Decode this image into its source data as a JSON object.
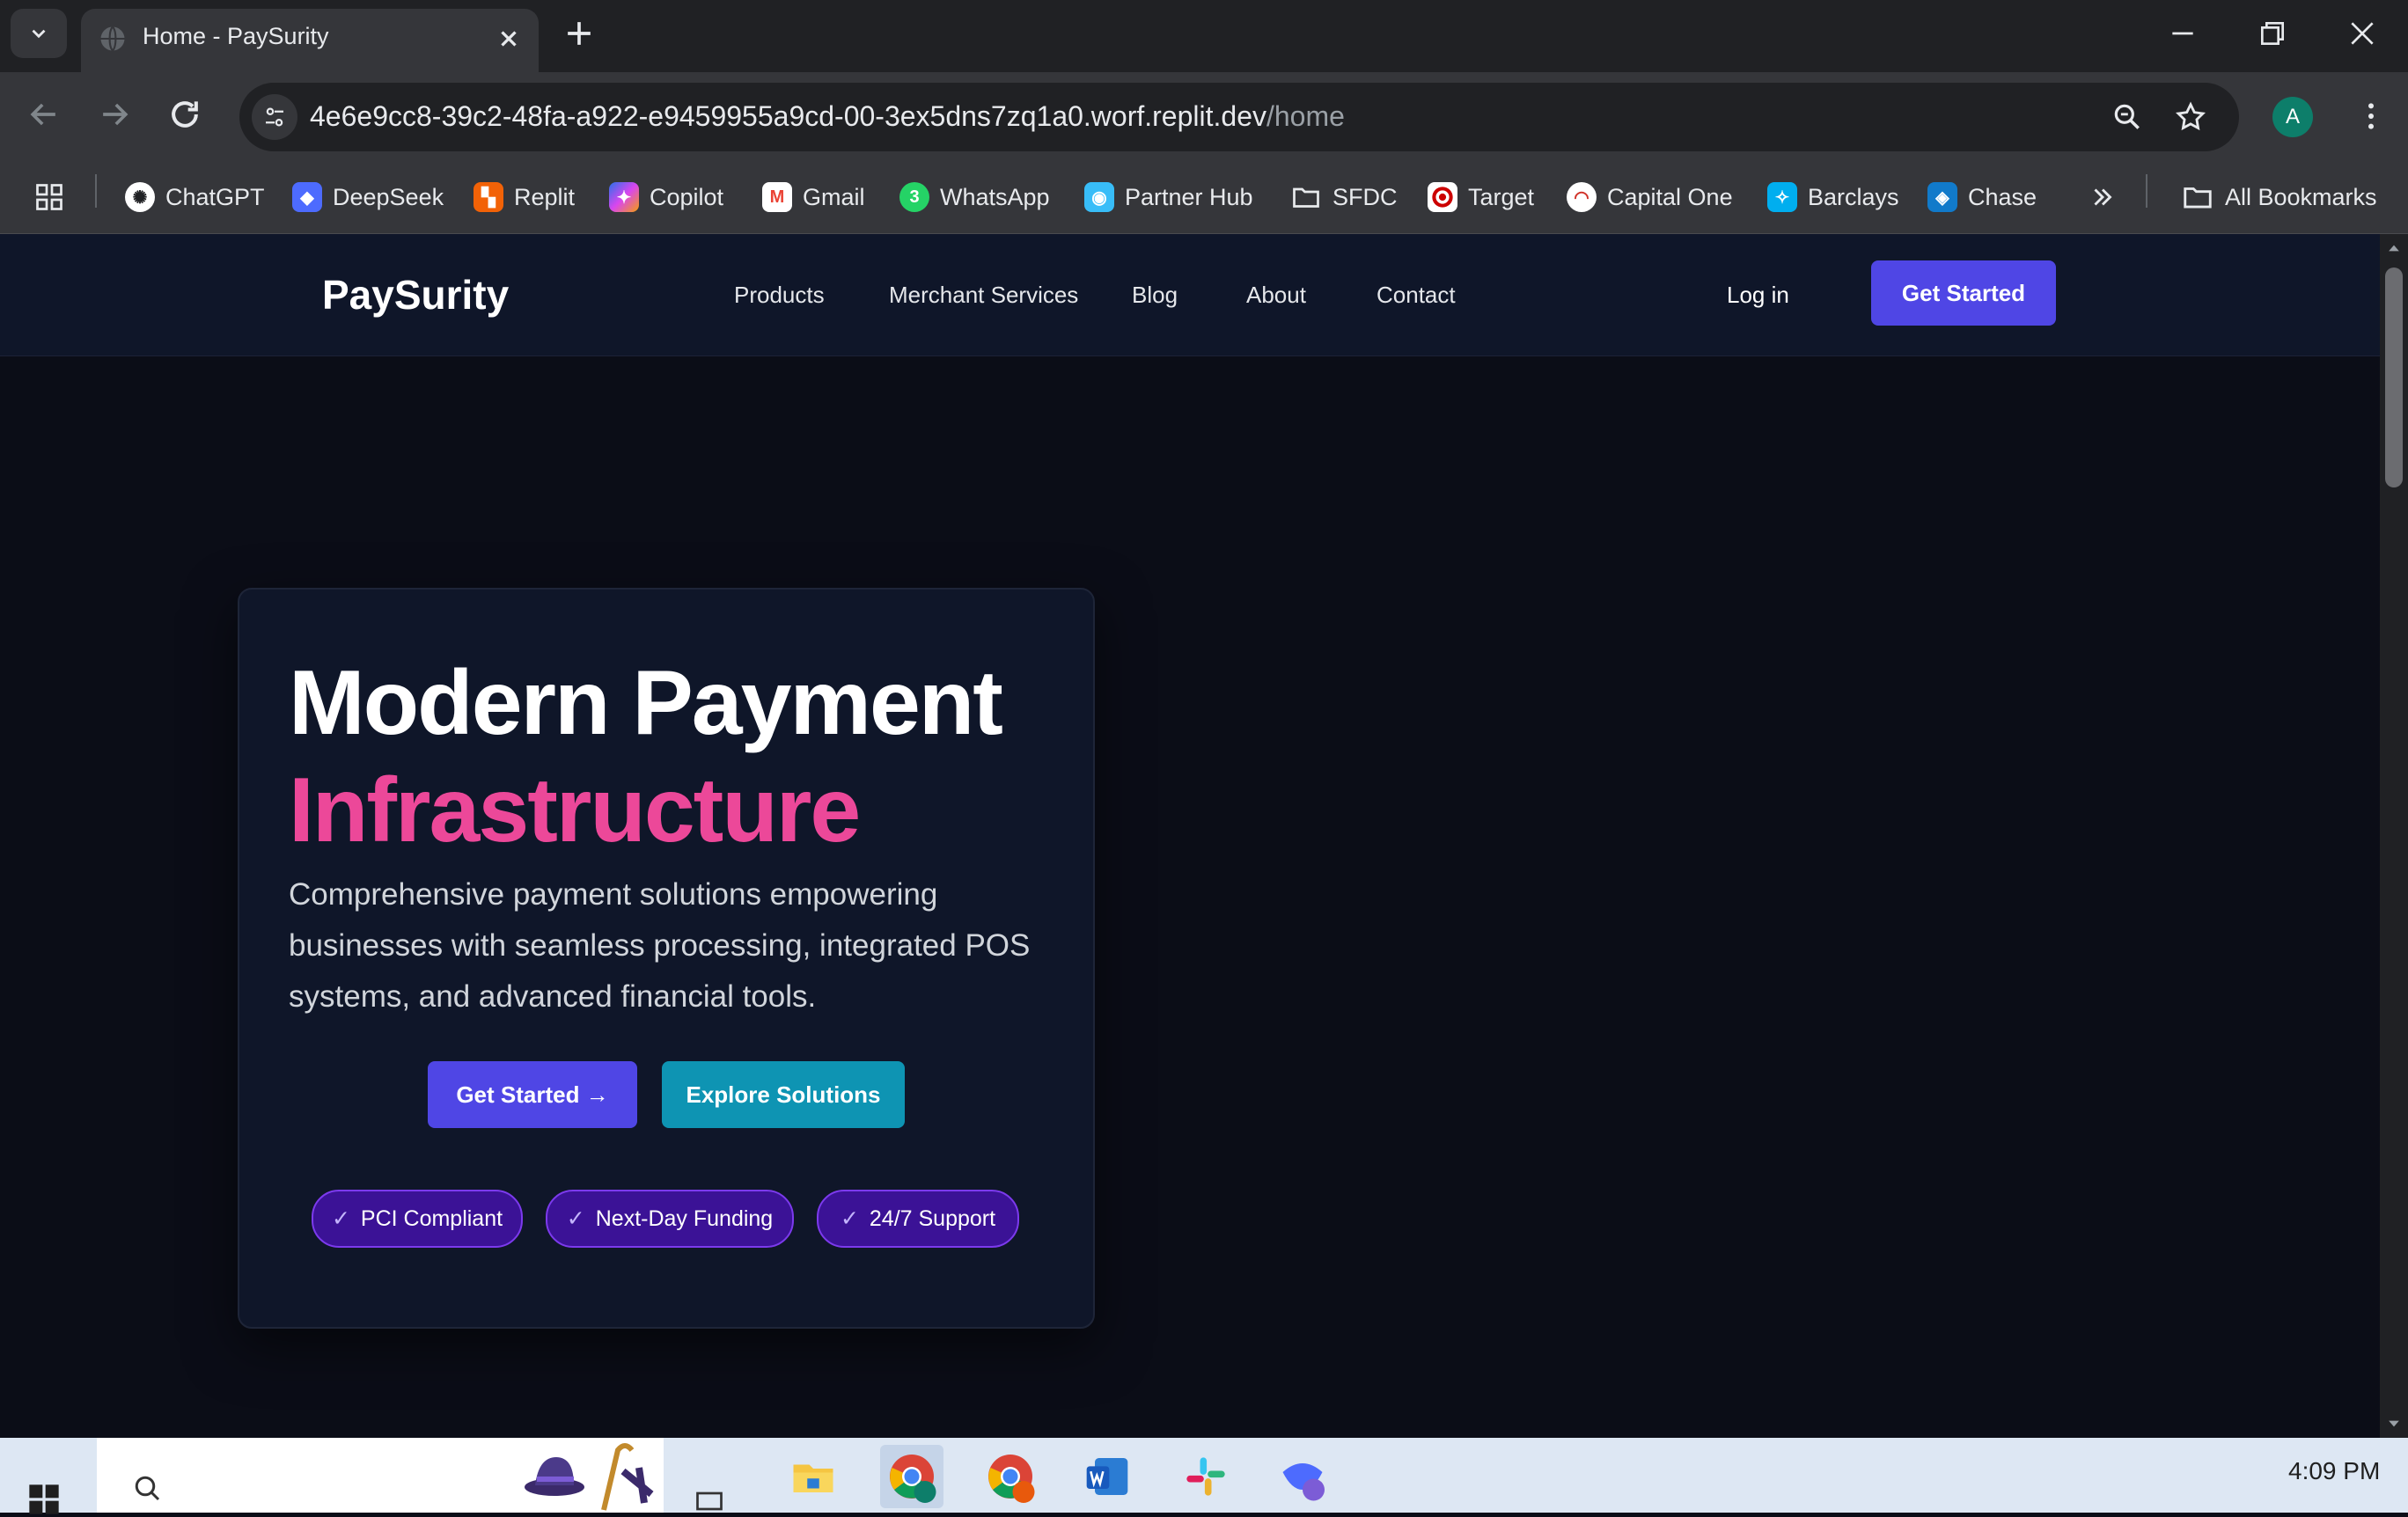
{
  "browser": {
    "tab_title": "Home - PaySurity",
    "url_host": "4e6e9cc8-39c2-48fa-a922-e9459955a9cd-00-3ex5dns7zq1a0.worf.replit.dev",
    "url_path": "/home",
    "profile_initial": "A",
    "bookmarks": [
      {
        "label": "ChatGPT",
        "icon": "chatgpt-icon"
      },
      {
        "label": "DeepSeek",
        "icon": "deepseek-icon"
      },
      {
        "label": "Replit",
        "icon": "replit-icon"
      },
      {
        "label": "Copilot",
        "icon": "copilot-icon"
      },
      {
        "label": "Gmail",
        "icon": "gmail-icon"
      },
      {
        "label": "WhatsApp",
        "icon": "whatsapp-icon"
      },
      {
        "label": "Partner Hub",
        "icon": "partner-hub-icon"
      },
      {
        "label": "SFDC",
        "icon": "folder-icon"
      },
      {
        "label": "Target",
        "icon": "target-icon"
      },
      {
        "label": "Capital One",
        "icon": "capital-one-icon"
      },
      {
        "label": "Barclays",
        "icon": "barclays-icon"
      },
      {
        "label": "Chase",
        "icon": "chase-icon"
      }
    ],
    "all_bookmarks": "All Bookmarks",
    "whatsapp_badge": "3"
  },
  "site": {
    "logo": "PaySurity",
    "nav": [
      "Products",
      "Merchant Services",
      "Blog",
      "About",
      "Contact"
    ],
    "login": "Log in",
    "header_cta": "Get Started"
  },
  "hero": {
    "title_line1": "Modern Payment",
    "title_line2": "Infrastructure",
    "description": "Comprehensive payment solutions empowering businesses with seamless processing, integrated POS systems, and advanced financial tools.",
    "primary_cta": "Get Started →",
    "secondary_cta": "Explore Solutions",
    "badges": [
      {
        "check": "✓",
        "label": "PCI Compliant"
      },
      {
        "check": "✓",
        "label": "Next-Day Funding"
      },
      {
        "check": "✓",
        "label": "24/7 Support"
      }
    ]
  },
  "taskbar": {
    "time": "4:09 PM"
  },
  "colors": {
    "brand_primary": "#4f46e5",
    "accent_pink": "#ec4899",
    "accent_teal": "#0e94b3",
    "badge_purple": "#3b1296",
    "page_bg": "#0b0d17"
  }
}
